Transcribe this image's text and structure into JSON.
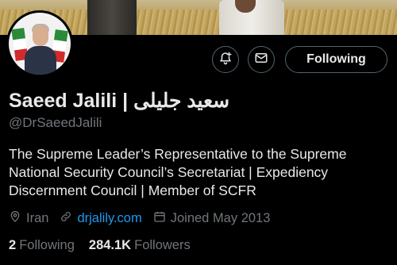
{
  "profile": {
    "display_name": "Saeed Jalili | سعيد جليلى",
    "handle": "@DrSaeedJalili",
    "bio": "The Supreme Leader’s Representative to the Supreme National Security Council’s Secretariat | Expediency Discernment Council | Member of SCFR",
    "location": "Iran",
    "website": "drjalily.com",
    "joined": "Joined May 2013",
    "following_count": "2",
    "following_label": "Following",
    "followers_count": "284.1K",
    "followers_label": "Followers"
  },
  "actions": {
    "following_button": "Following"
  },
  "icons": {
    "notify": "bell-plus-icon",
    "message": "envelope-icon",
    "location": "location-pin-icon",
    "link": "link-icon",
    "calendar": "calendar-icon"
  },
  "colors": {
    "background": "#000000",
    "text": "#e7e9ea",
    "muted": "#71767b",
    "link": "#1d9bf0",
    "border": "#536471"
  }
}
